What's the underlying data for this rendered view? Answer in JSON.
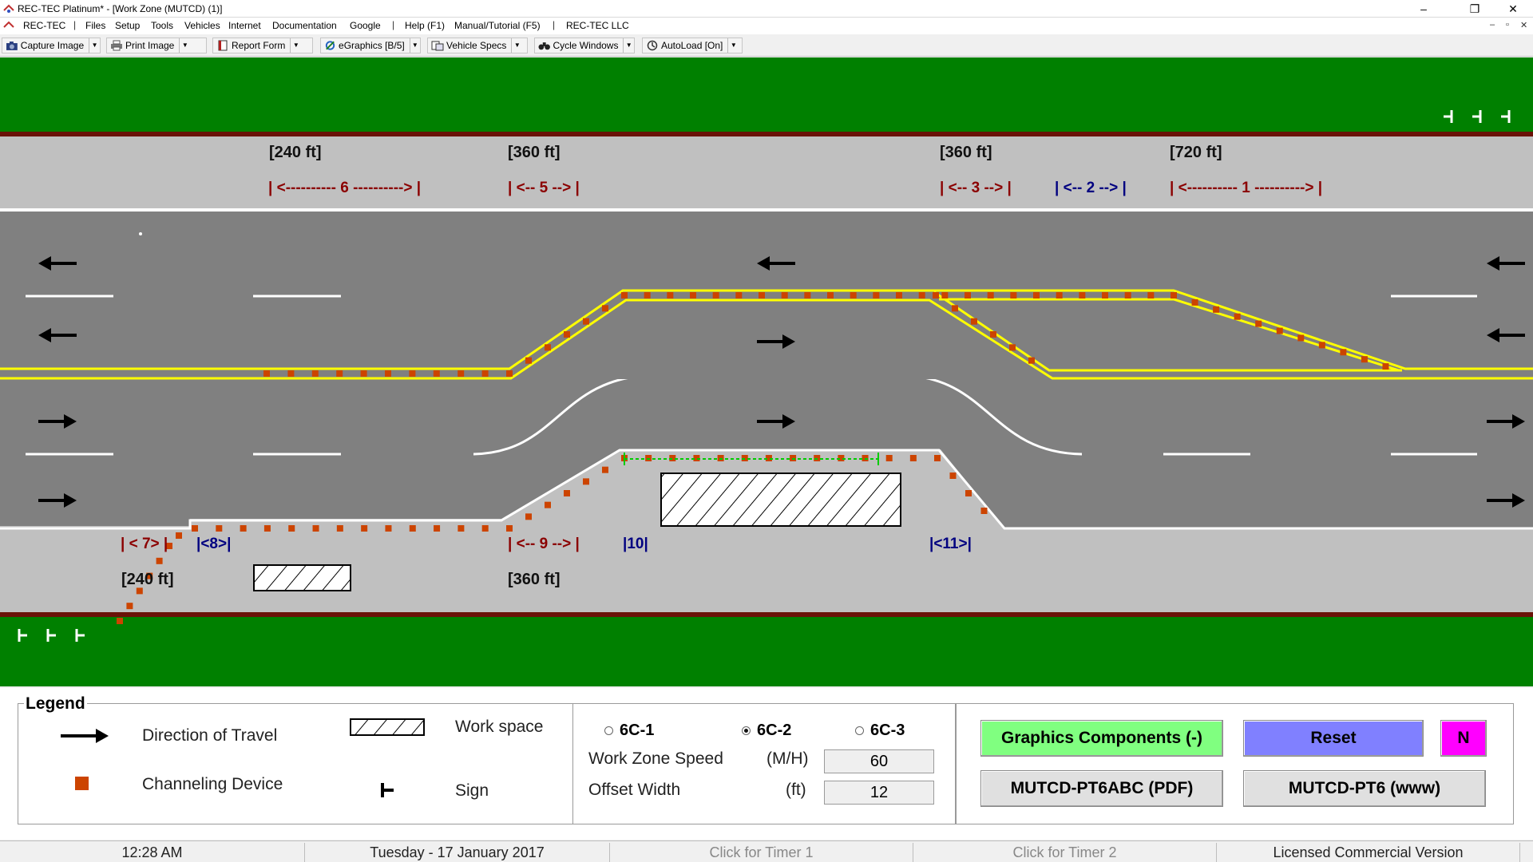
{
  "window": {
    "title": "REC-TEC Platinum* - [Work Zone (MUTCD) (1)]",
    "controls": {
      "minimize": "‒",
      "maximize": "❐",
      "close": "✕"
    }
  },
  "menubar": {
    "items": [
      "REC-TEC",
      "|",
      "Files",
      "Setup",
      "Tools",
      "Vehicles",
      "Internet",
      "Documentation",
      "Google",
      "|",
      "Help (F1)",
      "Manual/Tutorial (F5)",
      "|",
      "REC-TEC LLC"
    ],
    "mdi_controls": [
      "‒",
      "▫",
      "✕"
    ]
  },
  "toolbar": {
    "buttons": [
      {
        "label": "Capture Image",
        "icon": "camera-icon"
      },
      {
        "label": "Print Image",
        "icon": "printer-icon"
      },
      {
        "label": "Report Form",
        "icon": "report-icon"
      },
      {
        "label": "eGraphics [B/5]",
        "icon": "egraphics-icon"
      },
      {
        "label": "Vehicle Specs",
        "icon": "vehicle-specs-icon"
      },
      {
        "label": "Cycle Windows",
        "icon": "binoculars-icon"
      },
      {
        "label": "AutoLoad [On]",
        "icon": "autoload-icon"
      }
    ]
  },
  "diagram": {
    "top_lengths": [
      "[240  ft]",
      "[360  ft]",
      "[360  ft]",
      "[720  ft]"
    ],
    "top_zones": [
      "| <---------- 6 ----------> |",
      "| <-- 5 --> |",
      "| <-- 3 --> |",
      "| <-- 2 --> |",
      "| <---------- 1 ----------> |"
    ],
    "bottom_zones": [
      "| < 7> |",
      "|<8>|",
      "| <-- 9 --> |",
      "|10|",
      "|<11>|"
    ],
    "bottom_lengths": [
      "[240  ft]",
      "[360  ft]"
    ],
    "colors": {
      "grass": "#008000",
      "road": "#808080",
      "shoulder": "#c0c0c0",
      "curb": "#7a1a10",
      "centerline": "#ffff00",
      "cone": "#cc4400",
      "zone_red": "#8b0000",
      "zone_blue": "#000080"
    }
  },
  "legend": {
    "title": "Legend",
    "direction": "Direction of Travel",
    "channeling": "Channeling Device",
    "workspace": "Work space",
    "sign": "Sign"
  },
  "params": {
    "options": [
      {
        "label": "6C-1",
        "selected": false
      },
      {
        "label": "6C-2",
        "selected": true
      },
      {
        "label": "6C-3",
        "selected": false
      }
    ],
    "speed_label": "Work Zone Speed",
    "speed_unit": "(M/H)",
    "speed_value": "60",
    "offset_label": "Offset Width",
    "offset_unit": "(ft)",
    "offset_value": "12"
  },
  "buttons": {
    "graphics": "Graphics Components (-)",
    "reset": "Reset",
    "n": "N",
    "pdf": "MUTCD-PT6ABC  (PDF)",
    "www": "MUTCD-PT6  (www)",
    "colors": {
      "graphics": "#80ff80",
      "reset": "#8080ff",
      "n": "#ff00ff",
      "plain": "#e0e0e0"
    }
  },
  "status": {
    "time": "12:28 AM",
    "date": "Tuesday   -  17 January 2017",
    "timer1": "Click for Timer 1",
    "timer2": "Click for Timer 2",
    "license": "Licensed Commercial Version"
  }
}
